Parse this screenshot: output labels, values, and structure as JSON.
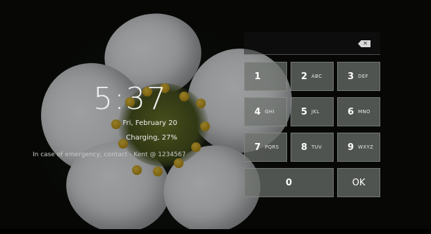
{
  "lockscreen": {
    "time": "5:37",
    "date": "Fri, February 20",
    "charging": "Charging, 27%",
    "owner_info": "In case of emergency, contact - Kent @ 1234567"
  },
  "pin_entry": {
    "value": "",
    "backspace_icon": "backspace-icon"
  },
  "keypad": {
    "keys": [
      {
        "digit": "1",
        "letters": ""
      },
      {
        "digit": "2",
        "letters": "ABC"
      },
      {
        "digit": "3",
        "letters": "DEF"
      },
      {
        "digit": "4",
        "letters": "GHI"
      },
      {
        "digit": "5",
        "letters": "JKL"
      },
      {
        "digit": "6",
        "letters": "MNO"
      },
      {
        "digit": "7",
        "letters": "PQRS"
      },
      {
        "digit": "8",
        "letters": "TUV"
      },
      {
        "digit": "9",
        "letters": "WXYZ"
      },
      {
        "digit": "0",
        "letters": ""
      }
    ],
    "ok_label": "OK"
  }
}
